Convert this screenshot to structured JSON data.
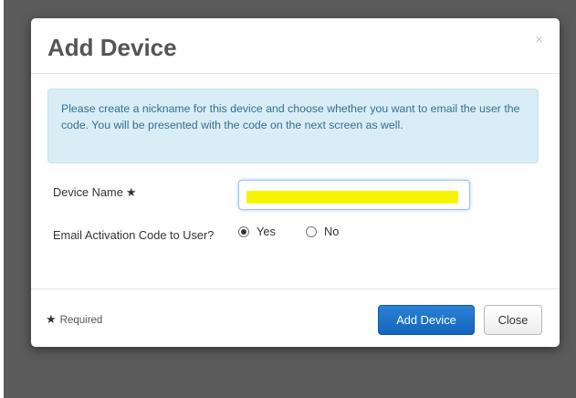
{
  "modal": {
    "title": "Add Device",
    "close_glyph": "×",
    "info_message": "Please create a nickname for this device and choose whether you want to email the user the code. You will be presented with the code on the next screen as well."
  },
  "form": {
    "device_name_label": "Device Name",
    "device_name_value": "",
    "device_name_redacted": true,
    "required_marker": "★",
    "email_code_label": "Email Activation Code to User?",
    "email_code_options": [
      {
        "label": "Yes",
        "selected": true
      },
      {
        "label": "No",
        "selected": false
      }
    ]
  },
  "footer": {
    "required_star": "★",
    "required_note": "Required",
    "add_device_label": "Add Device",
    "close_label": "Close"
  },
  "colors": {
    "primary_button": "#1a72c9",
    "info_background": "#d9edf7",
    "info_text": "#31708f",
    "redaction": "#f5f500",
    "backdrop": "#5b5b5b"
  }
}
